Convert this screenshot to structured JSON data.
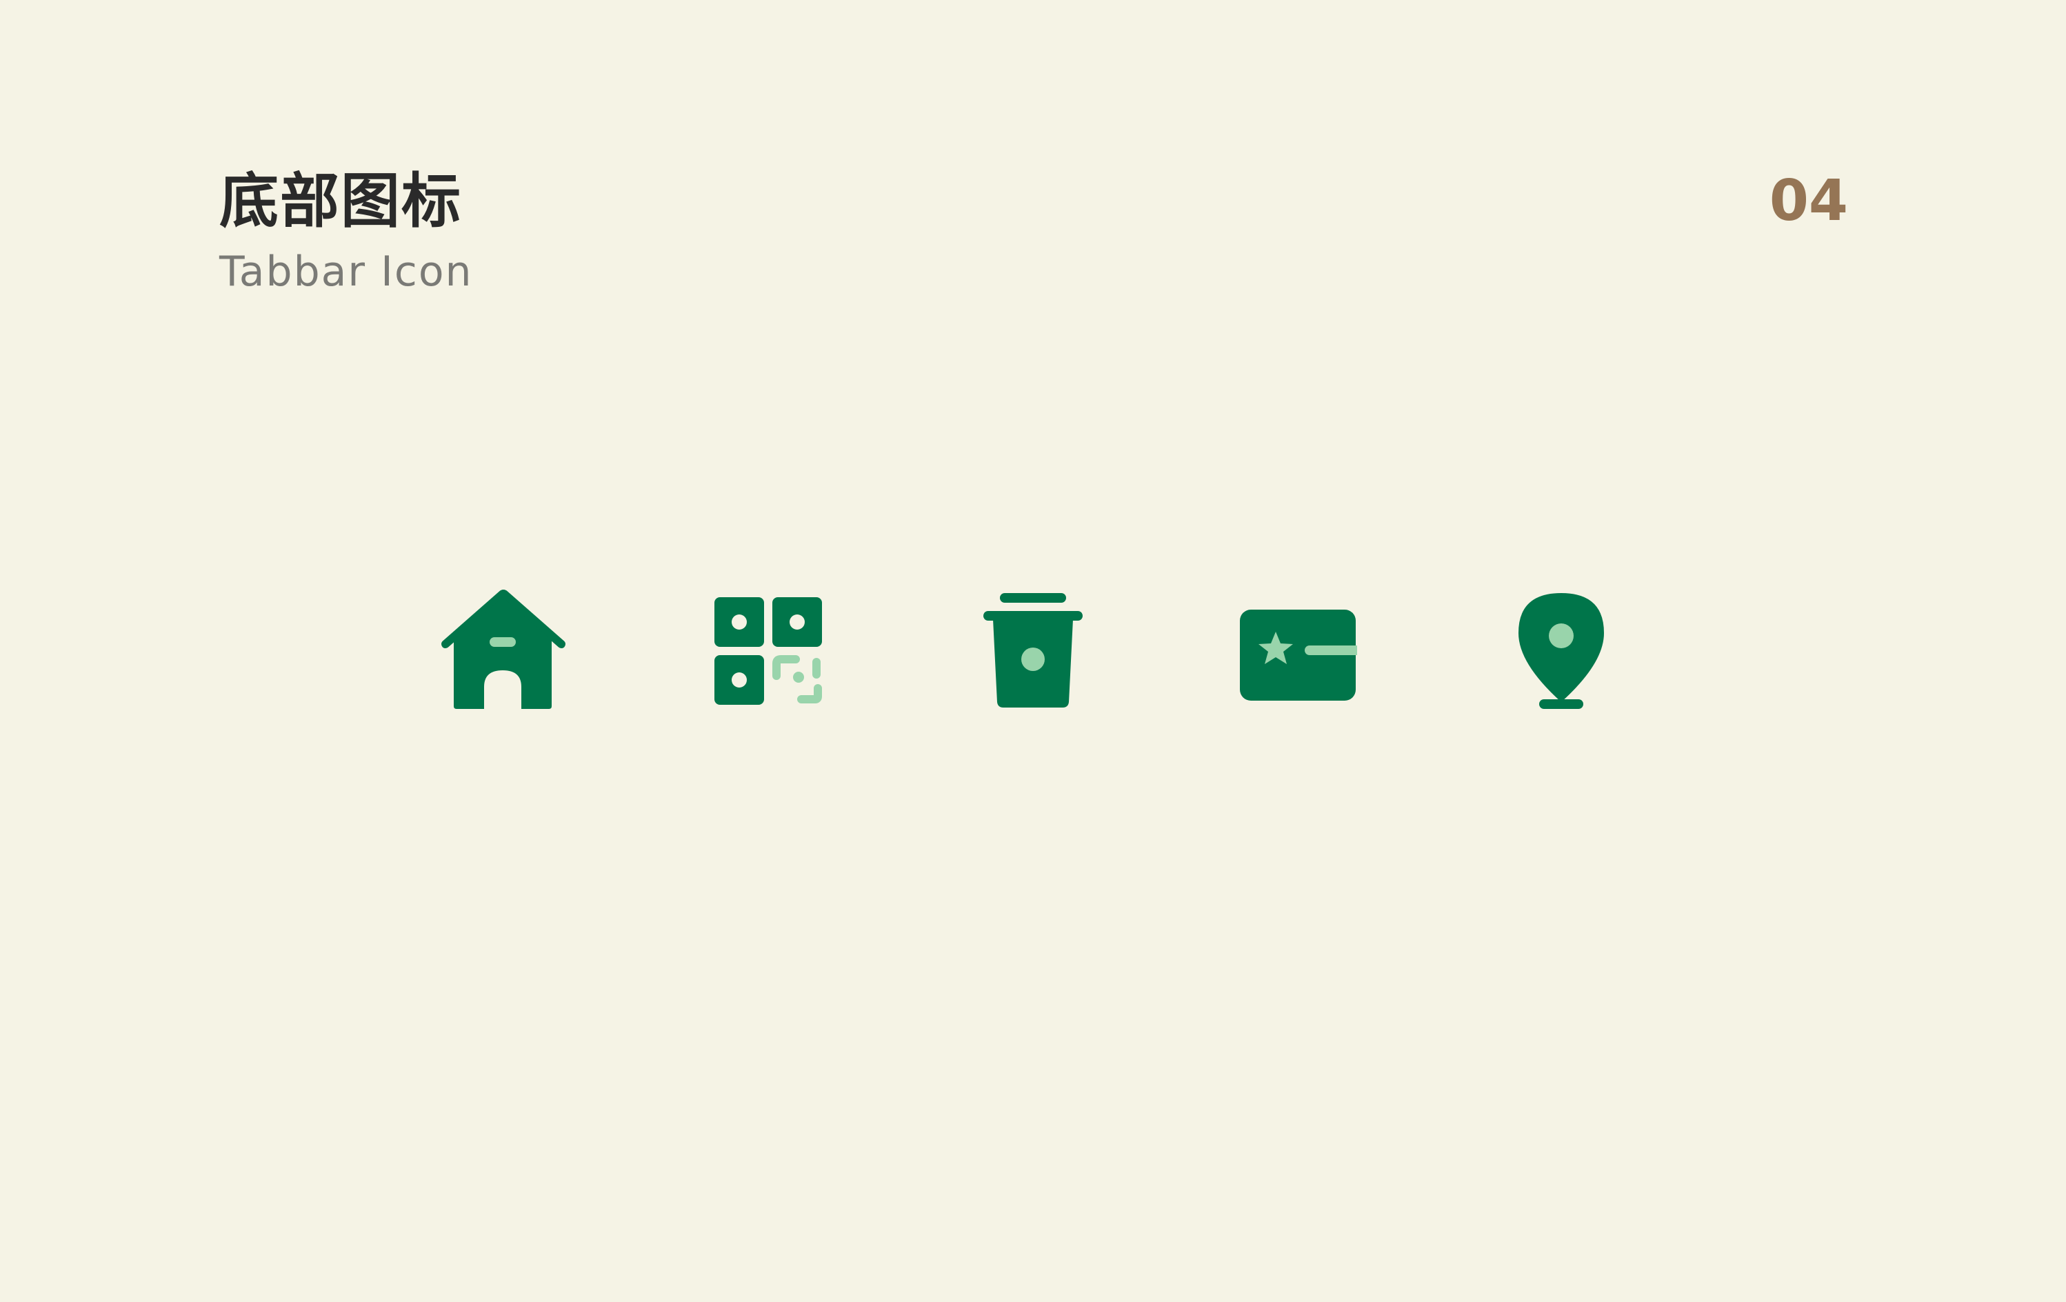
{
  "header": {
    "title": "底部图标",
    "subtitle": "Tabbar Icon",
    "page_number": "04"
  },
  "colors": {
    "background": "#f5f3e5",
    "icon_primary": "#00754a",
    "icon_accent": "#99d4ab",
    "title": "#2a2a2a",
    "subtitle": "#7a7a76",
    "page_number": "#957555"
  },
  "icons": [
    "home-icon",
    "qr-code-icon",
    "coffee-cup-icon",
    "star-card-icon",
    "location-pin-icon"
  ]
}
